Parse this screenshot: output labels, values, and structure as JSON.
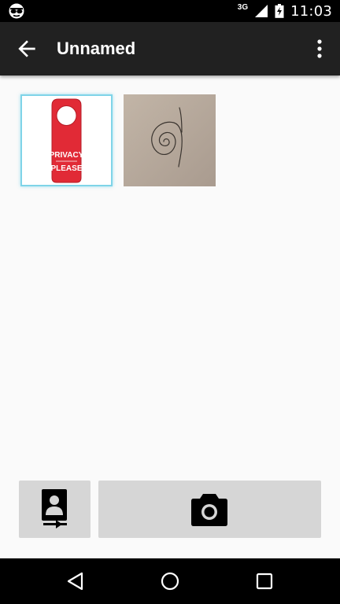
{
  "status_bar": {
    "network": "3G",
    "time": "11:03",
    "icons": [
      "incognito-icon",
      "signal-icon",
      "battery-icon"
    ]
  },
  "toolbar": {
    "title": "Unnamed",
    "back_icon": "arrow-back-icon",
    "menu_icon": "more-vert-icon"
  },
  "gallery": {
    "items": [
      {
        "kind": "photo",
        "subject": "door-hanger",
        "text_line1": "PRIVACY",
        "text_line2": "PLEASE",
        "selected": true
      },
      {
        "kind": "photo",
        "subject": "spiral-drawing",
        "selected": false
      }
    ]
  },
  "actions": {
    "import_icon": "import-photo-icon",
    "camera_icon": "camera-icon"
  },
  "nav_bar": {
    "icons": [
      "nav-back-icon",
      "nav-home-icon",
      "nav-recents-icon"
    ]
  },
  "colors": {
    "toolbar": "#212121",
    "background": "#fafafa",
    "button": "#d6d6d6",
    "selected_border": "#7fd4e8",
    "hanger_red": "#e12a36"
  }
}
